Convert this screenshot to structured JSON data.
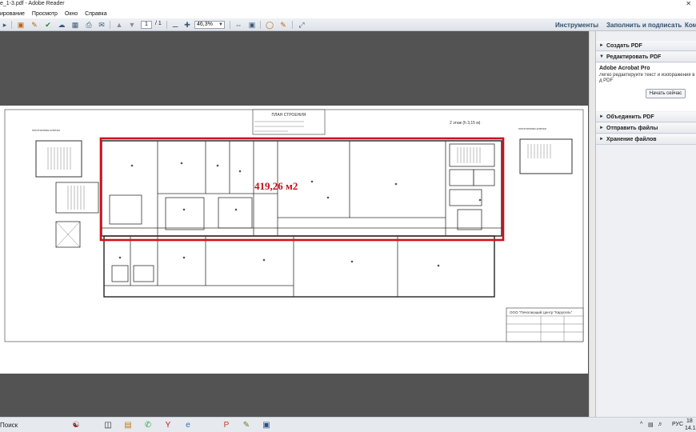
{
  "window": {
    "title": "e_1-3.pdf - Adobe Reader",
    "close_glyph": "✕"
  },
  "menu": {
    "items": [
      "ирование",
      "Просмотр",
      "Окно",
      "Справка"
    ]
  },
  "toolbar": {
    "page_current": "1",
    "page_total": "/ 1",
    "zoom": "46,3%",
    "tools_label": "Инструменты",
    "fill_sign_label": "Заполнить и подписать",
    "comment_label": "Ком"
  },
  "document": {
    "stamp_title": "ПЛАН СТРОЕНИЯ",
    "area_label": "419,26 м2",
    "floor_label": "2 этаж (h 3,15 м)",
    "stair_left_label": "лестничная клетка",
    "stair_right_label": "лестничная клетка",
    "org_stamp": "ООО \"Печатающий Центр \"Карусель\""
  },
  "sidebar": {
    "create_pdf": "Создать PDF",
    "edit_pdf": "Редактировать PDF",
    "product": "Adobe Acrobat Pro",
    "description": "Легко редактируйте текст и изображения в д PDF",
    "buy_button": "Начать сейчас",
    "combine_pdf": "Объединить PDF",
    "send_files": "Отправить файлы",
    "store_files": "Хранение файлов"
  },
  "taskbar": {
    "search": "Поиск",
    "lang": "РУС",
    "time": "18",
    "date": "14.1"
  },
  "colors": {
    "doc_background": "#535353",
    "highlight_red": "#d0101c"
  }
}
